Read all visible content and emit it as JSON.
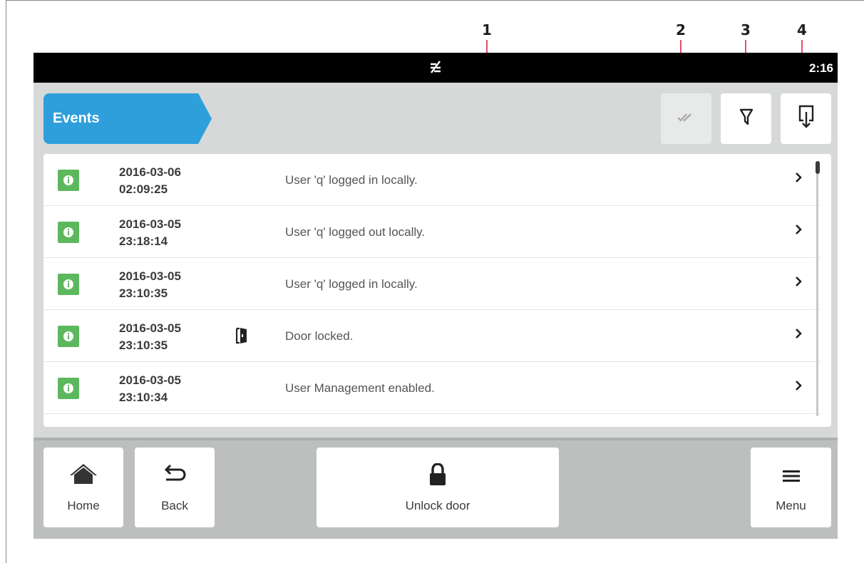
{
  "callouts": [
    "1",
    "2",
    "3",
    "4"
  ],
  "status_bar": {
    "icon": "network-off-icon",
    "time": "2:16"
  },
  "header": {
    "title": "Events"
  },
  "toolbar": {
    "acknowledge_icon": "double-check-icon",
    "filter_icon": "filter-icon",
    "export_icon": "export-icon"
  },
  "events": [
    {
      "date": "2016-03-06",
      "time": "02:09:25",
      "message": "User 'q' logged in locally.",
      "type_icon": "info-icon",
      "extra_icon": ""
    },
    {
      "date": "2016-03-05",
      "time": "23:18:14",
      "message": "User 'q' logged out locally.",
      "type_icon": "info-icon",
      "extra_icon": ""
    },
    {
      "date": "2016-03-05",
      "time": "23:10:35",
      "message": "User 'q' logged in locally.",
      "type_icon": "info-icon",
      "extra_icon": ""
    },
    {
      "date": "2016-03-05",
      "time": "23:10:35",
      "message": "Door locked.",
      "type_icon": "info-icon",
      "extra_icon": "door-icon"
    },
    {
      "date": "2016-03-05",
      "time": "23:10:34",
      "message": "User Management enabled.",
      "type_icon": "info-icon",
      "extra_icon": ""
    }
  ],
  "bottom_nav": {
    "home_label": "Home",
    "back_label": "Back",
    "unlock_label": "Unlock door",
    "menu_label": "Menu"
  },
  "colors": {
    "accent": "#2f9fdc",
    "info_badge": "#5cb85c",
    "callout": "#e2506e",
    "status_bar": "#000000"
  }
}
